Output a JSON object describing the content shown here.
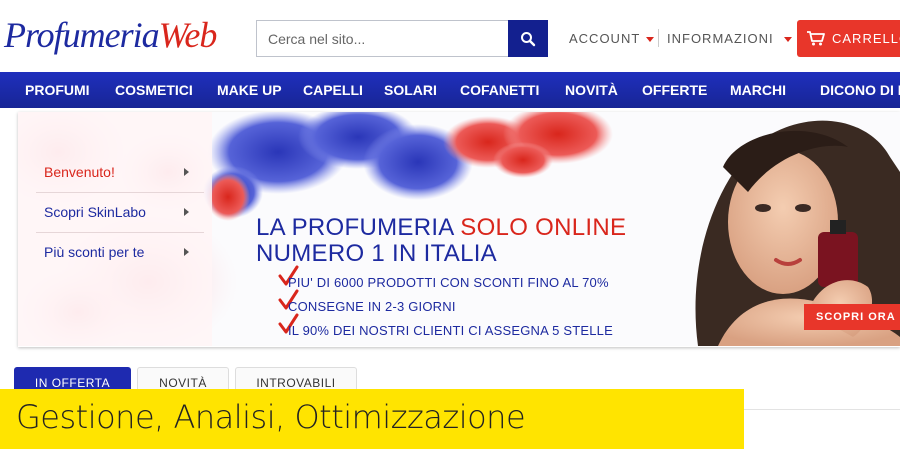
{
  "header": {
    "logo_part1": "Profumeria",
    "logo_part2": "Web",
    "search_placeholder": "Cerca nel sito...",
    "account_label": "ACCOUNT",
    "info_label": "INFORMAZIONI",
    "cart_label": "CARRELLO"
  },
  "nav": {
    "items": [
      "PROFUMI",
      "COSMETICI",
      "MAKE UP",
      "CAPELLI",
      "SOLARI",
      "COFANETTI",
      "NOVITÀ",
      "OFFERTE",
      "MARCHI",
      "DICONO DI N"
    ]
  },
  "side_menu": {
    "items": [
      {
        "label": "Benvenuto!",
        "color": "#d9261c"
      },
      {
        "label": "Scopri SkinLabo",
        "color": "#1d2aa0"
      },
      {
        "label": "Più sconti per te",
        "color": "#1d2aa0"
      }
    ]
  },
  "banner": {
    "title_part1": "LA PROFUMERIA ",
    "title_part2": "SOLO ONLINE",
    "title_line2": "NUMERO 1 IN ITALIA",
    "bullets": [
      "PIU' DI 6000 PRODOTTI CON SCONTI FINO AL 70%",
      "CONSEGNE IN 2-3 GIORNI",
      "IL 90% DEI NOSTRI CLIENTI CI ASSEGNA 5 STELLE"
    ],
    "cta_label": "SCOPRI ORA"
  },
  "tabs": {
    "items": [
      "IN OFFERTA",
      "NOVITÀ",
      "INTROVABILI"
    ],
    "active_index": 0
  },
  "caption": {
    "text": "Gestione, Analisi, Ottimizzazione"
  },
  "colors": {
    "brand_blue": "#1d2aa0",
    "brand_red": "#d9261c",
    "caption_yellow": "#ffe400"
  }
}
